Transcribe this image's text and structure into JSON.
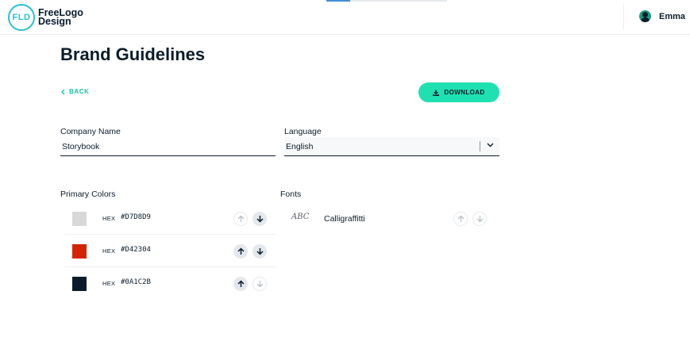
{
  "header": {
    "logo_mark": "FLD",
    "logo_line1": "FreeLogo",
    "logo_line2": "Design",
    "user_name": "Emma",
    "progress_fraction": 0.2
  },
  "page": {
    "title": "Brand Guidelines",
    "back_label": "BACK",
    "download_label": "DOWNLOAD"
  },
  "form": {
    "company_label": "Company Name",
    "company_value": "Storybook",
    "language_label": "Language",
    "language_value": "English"
  },
  "colors": {
    "section_label": "Primary Colors",
    "hex_tag": "HEX",
    "items": [
      {
        "hex": "#D7D8D9",
        "up_enabled": false,
        "down_enabled": true
      },
      {
        "hex": "#D42304",
        "up_enabled": true,
        "down_enabled": true
      },
      {
        "hex": "#0A1C2B",
        "up_enabled": true,
        "down_enabled": false
      }
    ]
  },
  "fonts": {
    "section_label": "Fonts",
    "items": [
      {
        "sample": "ABC",
        "name": "Calligraffitti",
        "up_enabled": false,
        "down_enabled": false
      }
    ]
  },
  "theme": {
    "accent": "#1FE0B0",
    "accent_text": "#17C7A3",
    "logo_color": "#28C1D6",
    "text_dark": "#0A1C2B"
  }
}
